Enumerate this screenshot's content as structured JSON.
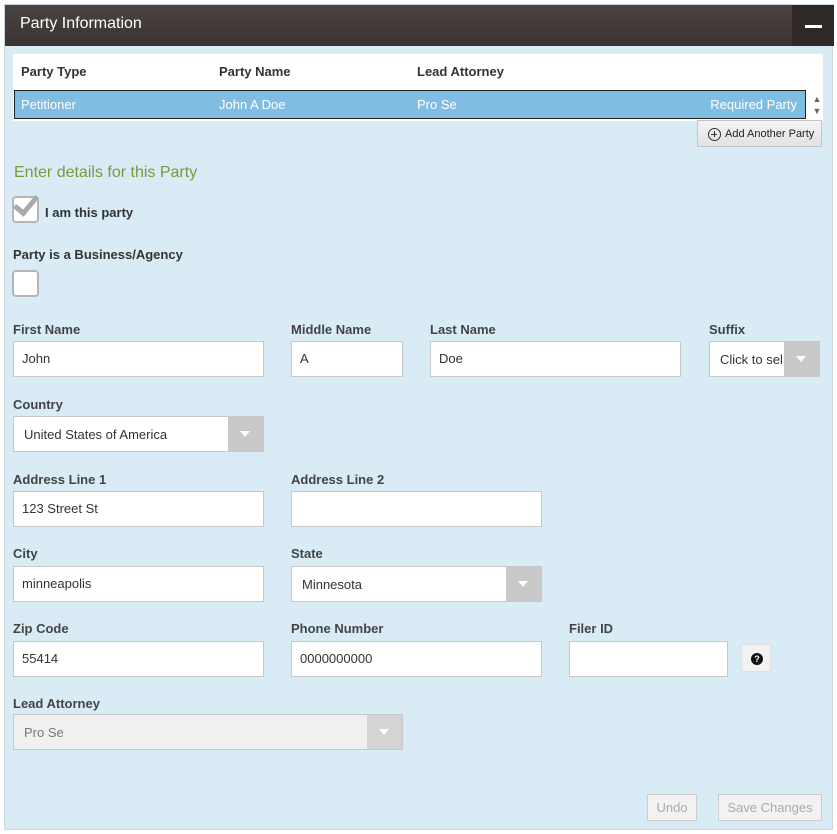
{
  "panel": {
    "title": "Party Information",
    "collapse_icon": "minus-icon"
  },
  "grid": {
    "headers": {
      "party_type": "Party Type",
      "party_name": "Party Name",
      "lead_attorney": "Lead Attorney"
    },
    "rows": [
      {
        "party_type": "Petitioner",
        "party_name": "John A Doe",
        "lead_attorney": "Pro Se",
        "status": "Required Party"
      }
    ],
    "row_highlight_color": "#7fbde3"
  },
  "add_party_button": {
    "label": "Add Another Party",
    "icon": "plus-circle-icon"
  },
  "section": {
    "title": "Enter details for this Party",
    "title_color": "#7a9a3a"
  },
  "i_am_this_party": {
    "label": "I am this party",
    "checked": true
  },
  "business": {
    "label": "Party is a Business/Agency",
    "checked": false
  },
  "fields": {
    "first_name": {
      "label": "First Name",
      "value": "John"
    },
    "middle_name": {
      "label": "Middle Name",
      "value": "A"
    },
    "last_name": {
      "label": "Last Name",
      "value": "Doe"
    },
    "suffix": {
      "label": "Suffix",
      "value": "Click to sel..."
    },
    "country": {
      "label": "Country",
      "value": "United States of America"
    },
    "address1": {
      "label": "Address Line 1",
      "value": "123 Street St"
    },
    "address2": {
      "label": "Address Line 2",
      "value": ""
    },
    "city": {
      "label": "City",
      "value": "minneapolis"
    },
    "state": {
      "label": "State",
      "value": "Minnesota"
    },
    "zip": {
      "label": "Zip Code",
      "value": "55414"
    },
    "phone": {
      "label": "Phone Number",
      "value": "0000000000"
    },
    "filer_id": {
      "label": "Filer ID",
      "value": ""
    },
    "lead_attorney": {
      "label": "Lead Attorney",
      "value": "Pro Se",
      "disabled": true
    }
  },
  "help_icon": "question-icon",
  "actions": {
    "undo": "Undo",
    "save": "Save Changes"
  },
  "colors": {
    "panel_bg": "#d9ebf5",
    "titlebar_bg": "#3f3836"
  }
}
